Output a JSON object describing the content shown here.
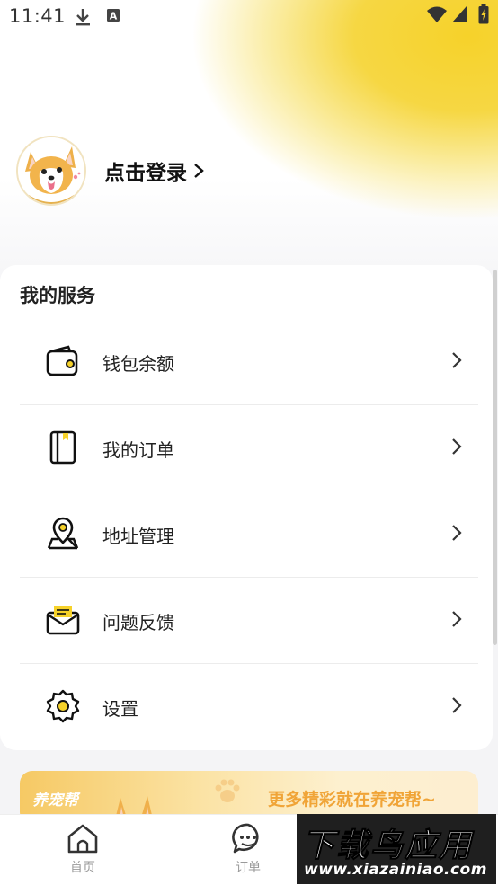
{
  "status_bar": {
    "time": "11:41",
    "icons": [
      "download-icon",
      "keyboard-a-icon",
      "wifi-icon",
      "signal-icon",
      "battery-charging-icon"
    ]
  },
  "profile": {
    "login_label": "点击登录"
  },
  "services": {
    "title": "我的服务",
    "items": [
      {
        "label": "钱包余额",
        "icon": "wallet-icon"
      },
      {
        "label": "我的订单",
        "icon": "order-book-icon"
      },
      {
        "label": "地址管理",
        "icon": "location-pin-icon"
      },
      {
        "label": "问题反馈",
        "icon": "feedback-mail-icon"
      },
      {
        "label": "设置",
        "icon": "gear-icon"
      }
    ]
  },
  "banner": {
    "brand": "养宠帮",
    "promo": "更多精彩就在养宠帮~"
  },
  "tabbar": {
    "tabs": [
      {
        "label": "首页",
        "icon": "home-icon"
      },
      {
        "label": "订单",
        "icon": "chat-bubble-icon"
      }
    ]
  },
  "watermark": {
    "big": "下载鸟应用",
    "small": "www.xiazainiao.com"
  },
  "colors": {
    "accent_yellow": "#f6d22a",
    "promo_orange": "#f0a437",
    "tab_inactive": "#9a9a9a"
  }
}
